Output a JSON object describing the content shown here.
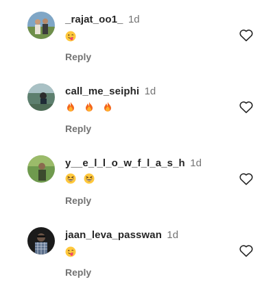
{
  "comments": [
    {
      "username": "_rajat_oo1_",
      "time": "1d",
      "emojis": [
        "winking-face-with-tongue-emoji"
      ],
      "reply_label": "Reply",
      "like_icon": "heart-outline-icon"
    },
    {
      "username": "call_me_seiphi",
      "time": "1d",
      "emojis": [
        "fire-emoji",
        "fire-emoji",
        "fire-emoji"
      ],
      "reply_label": "Reply",
      "like_icon": "heart-outline-icon"
    },
    {
      "username": "y__e_l_l_o_w_f_l_a_s_h",
      "time": "1d",
      "emojis": [
        "grinning-squinting-face-emoji",
        "grinning-squinting-face-emoji"
      ],
      "reply_label": "Reply",
      "like_icon": "heart-outline-icon"
    },
    {
      "username": "jaan_leva_passwan",
      "time": "1d",
      "emojis": [
        "winking-face-with-tongue-emoji"
      ],
      "reply_label": "Reply",
      "like_icon": "heart-outline-icon"
    }
  ],
  "colors": {
    "username": "#262626",
    "secondary_text": "#737373",
    "heart_outline": "#262626",
    "emoji_face": "#FFC83D",
    "fire_outer": "#F4661B",
    "fire_inner": "#FFB02E",
    "tongue": "#F4436C"
  }
}
